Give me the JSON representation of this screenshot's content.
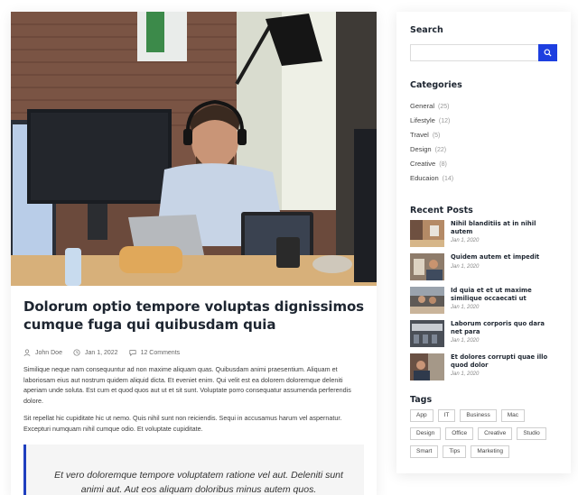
{
  "post": {
    "title": "Dolorum optio tempore voluptas dignissimos cumque fuga qui quibusdam quia",
    "author": "John Doe",
    "date": "Jan 1, 2022",
    "comments": "12 Comments",
    "paragraph1": "Similique neque nam consequuntur ad non maxime aliquam quas. Quibusdam animi praesentium. Aliquam et laboriosam eius aut nostrum quidem aliquid dicta. Et eveniet enim. Qui velit est ea dolorem doloremque deleniti aperiam unde soluta. Est cum et quod quos aut ut et sit sunt. Voluptate porro consequatur assumenda perferendis dolore.",
    "paragraph2": "Sit repellat hic cupiditate hic ut nemo. Quis nihil sunt non reiciendis. Sequi in accusamus harum vel aspernatur. Excepturi numquam nihil cumque odio. Et voluptate cupiditate.",
    "quote": "Et vero doloremque tempore voluptatem ratione vel aut. Deleniti sunt animi aut. Aut eos aliquam doloribus minus autem quos.",
    "hero_icon": "office-man-with-headset-photo"
  },
  "sidebar": {
    "search_title": "Search",
    "search_value": "",
    "search_icon": "search-icon",
    "categories_title": "Categories",
    "categories": [
      {
        "label": "General",
        "count": "(25)"
      },
      {
        "label": "Lifestyle",
        "count": "(12)"
      },
      {
        "label": "Travel",
        "count": "(5)"
      },
      {
        "label": "Design",
        "count": "(22)"
      },
      {
        "label": "Creative",
        "count": "(8)"
      },
      {
        "label": "Educaion",
        "count": "(14)"
      }
    ],
    "recent_title": "Recent Posts",
    "recent_posts": [
      {
        "title": "Nihil blanditiis at in nihil autem",
        "date": "Jan 1, 2020"
      },
      {
        "title": "Quidem autem et impedit",
        "date": "Jan 1, 2020"
      },
      {
        "title": "Id quia et et ut maxime similique occaecati ut",
        "date": "Jan 1, 2020"
      },
      {
        "title": "Laborum corporis quo dara net para",
        "date": "Jan 1, 2020"
      },
      {
        "title": "Et dolores corrupti quae illo quod dolor",
        "date": "Jan 1, 2020"
      }
    ],
    "tags_title": "Tags",
    "tags": [
      "App",
      "IT",
      "Business",
      "Mac",
      "Design",
      "Office",
      "Creative",
      "Studio",
      "Smart",
      "Tips",
      "Marketing"
    ]
  },
  "colors": {
    "accent": "#1d3fe0",
    "heading": "#1d2530",
    "quote_border": "#1f3fbf"
  }
}
